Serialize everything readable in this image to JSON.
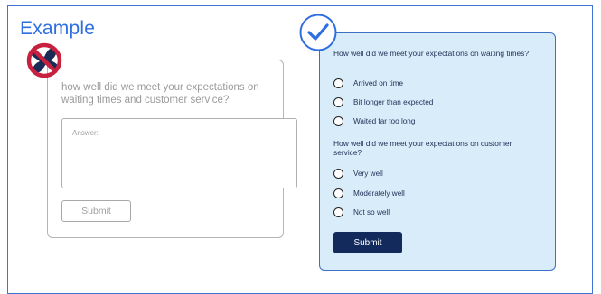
{
  "title": "Example",
  "bad_example": {
    "question": "how well did we meet your expectations on waiting times and customer service?",
    "answer_placeholder": "Answer:",
    "submit_label": "Submit",
    "icon": "no-entry-icon",
    "icon_color": "#c8213f"
  },
  "good_example": {
    "icon": "checkmark-icon",
    "accent_color": "#2f6ee0",
    "background_color": "#d8ecfa",
    "question1": "How well did we meet your expectations on waiting times?",
    "options1": [
      "Arrived on time",
      "Bit longer than expected",
      "Waited far too long"
    ],
    "question2": "How well did we meet your expectations on customer service?",
    "options2": [
      "Very well",
      "Moderately well",
      "Not so well"
    ],
    "submit_label": "Submit",
    "submit_color": "#122a5c"
  }
}
